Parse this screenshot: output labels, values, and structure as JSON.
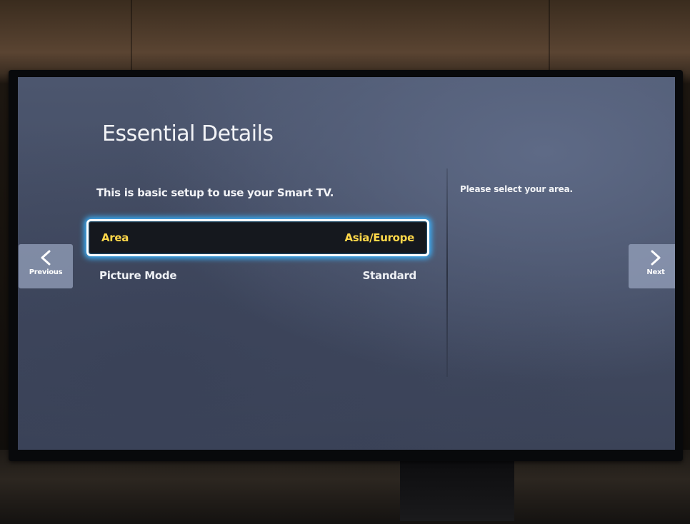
{
  "screen": {
    "title": "Essential Details",
    "subtitle": "This is basic setup to use your Smart TV.",
    "help_text": "Please select your area."
  },
  "settings": [
    {
      "label": "Area",
      "value": "Asia/Europe",
      "selected": true
    },
    {
      "label": "Picture Mode",
      "value": "Standard",
      "selected": false
    }
  ],
  "nav": {
    "previous_label": "Previous",
    "next_label": "Next"
  },
  "colors": {
    "screen_bg": "#454e66",
    "selection_highlight": "#ffd84a",
    "focus_glow": "#3ab4ff",
    "text": "#f2f3f6"
  },
  "icons": {
    "previous": "chevron-left-icon",
    "next": "chevron-right-icon"
  }
}
